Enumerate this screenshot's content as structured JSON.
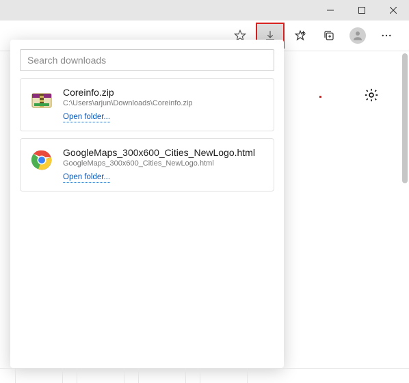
{
  "window": {
    "controls": {
      "minimize": "minimize",
      "maximize": "maximize",
      "close": "close"
    }
  },
  "toolbar": {
    "icons": {
      "star_outline": "favorite",
      "download": "downloads",
      "star_plus": "add-favorite",
      "collections": "collections",
      "profile": "profile",
      "more": "more"
    }
  },
  "downloads": {
    "search_placeholder": "Search downloads",
    "open_folder_label": "Open folder...",
    "items": [
      {
        "icon": "winrar",
        "name": "Coreinfo.zip",
        "path": "C:\\Users\\arjun\\Downloads\\Coreinfo.zip"
      },
      {
        "icon": "chrome",
        "name": "GoogleMaps_300x600_Cities_NewLogo.html",
        "path": "GoogleMaps_300x600_Cities_NewLogo.html"
      }
    ]
  },
  "page": {
    "settings_label": "settings"
  }
}
